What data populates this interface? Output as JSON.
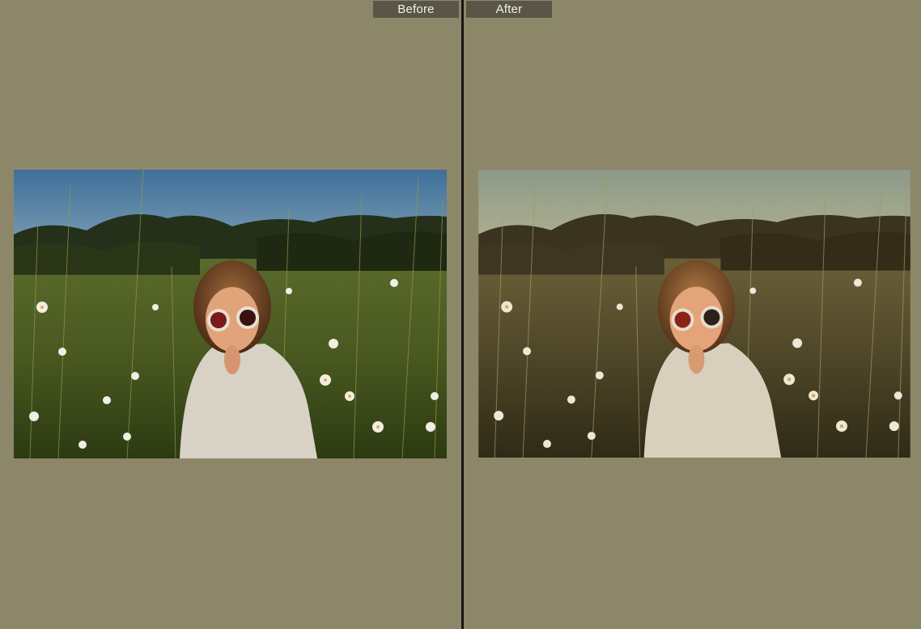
{
  "compare_view": {
    "before_label": "Before",
    "after_label": "After"
  },
  "colors": {
    "background": "#8d876a",
    "label_bg": "#5a5647",
    "divider": "#161616"
  },
  "photos": {
    "before": {
      "subject": "child-in-daisy-field-photo",
      "grade": "original"
    },
    "after": {
      "subject": "child-in-daisy-field-photo",
      "grade": "warm-faded"
    }
  }
}
